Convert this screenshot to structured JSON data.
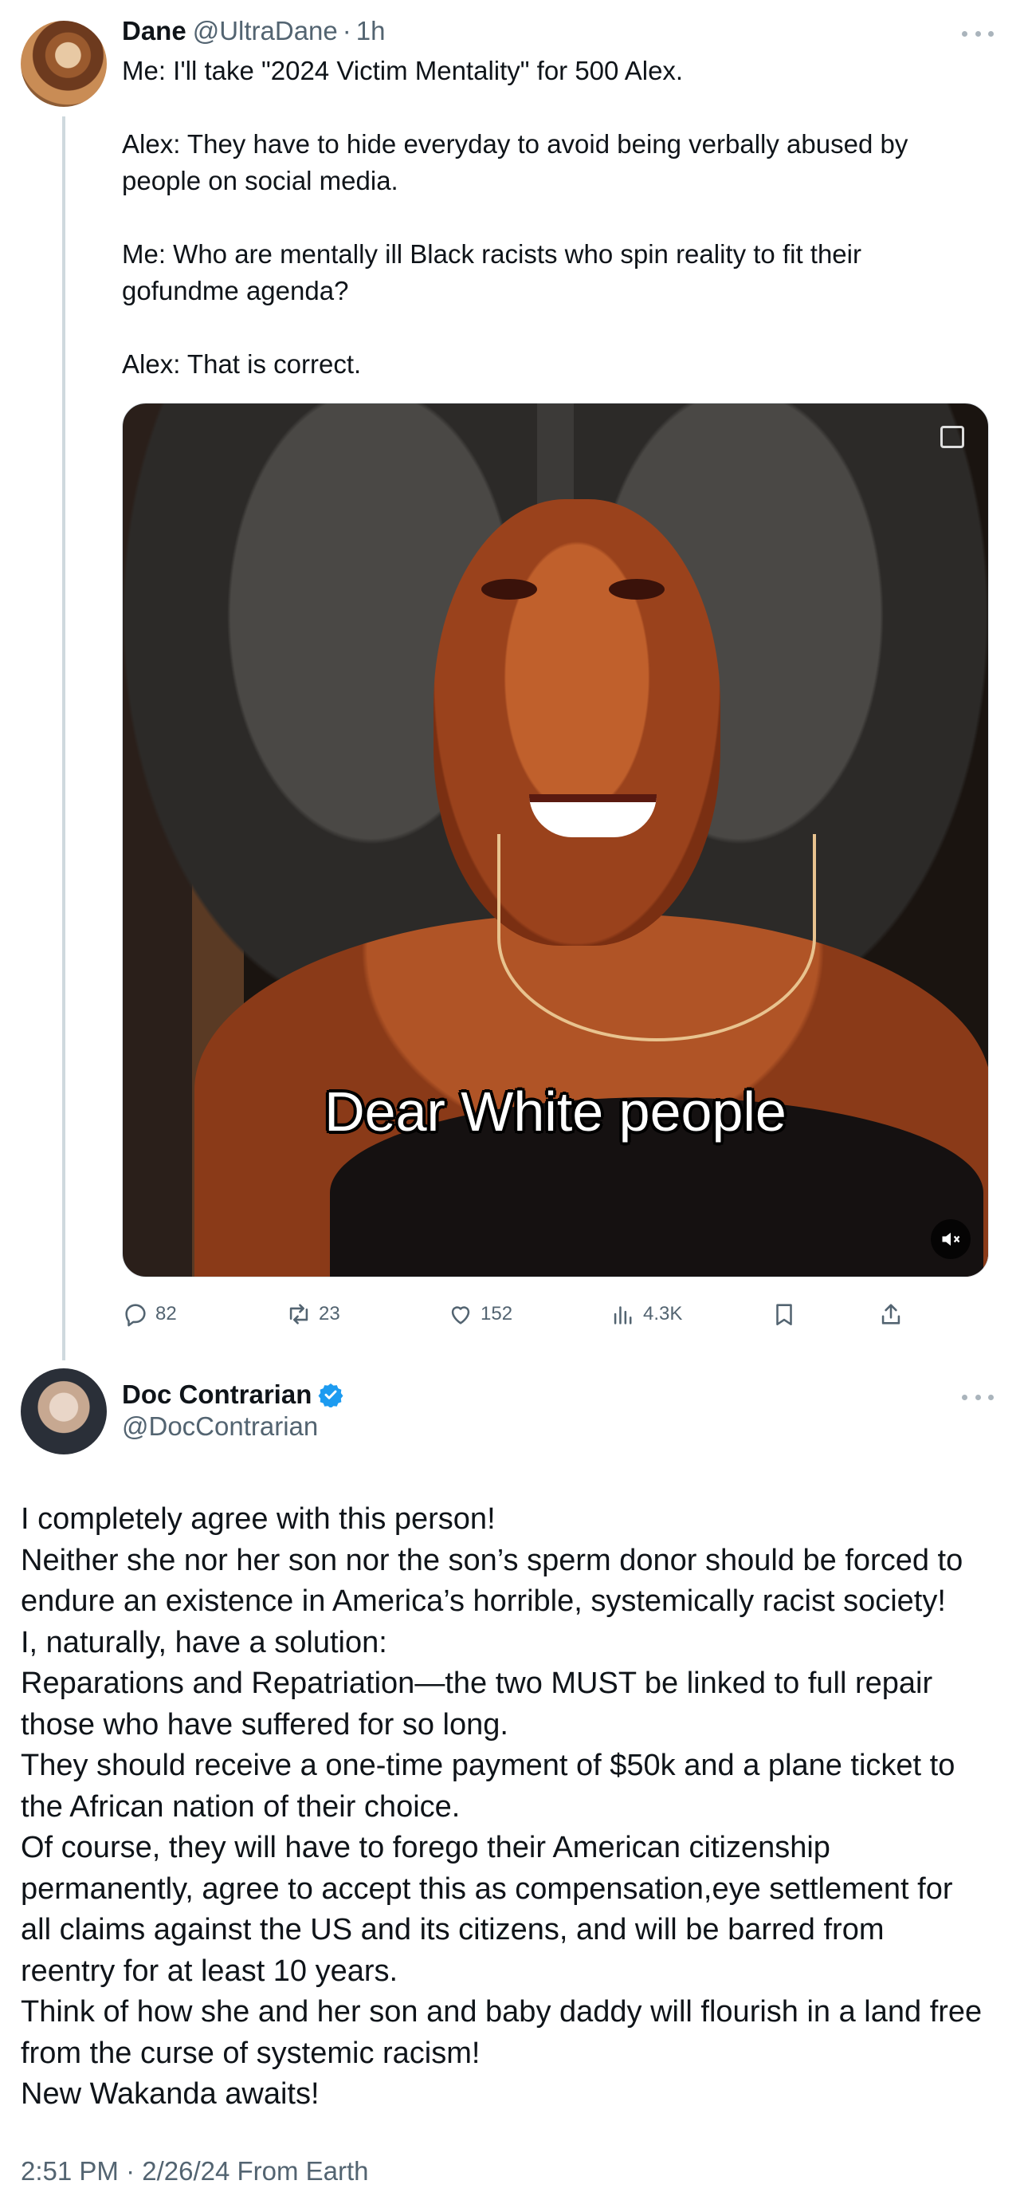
{
  "parent_tweet": {
    "author_name": "Dane",
    "author_handle": "@UltraDane",
    "separator": "·",
    "time": "1h",
    "text_lines": [
      "Me: I'll take \"2024 Victim Mentality\" for 500 Alex.",
      "",
      "Alex: They have to hide everyday to avoid being verbally abused by",
      "people on social media.",
      "",
      "Me: Who are mentally ill Black racists who spin reality to fit their",
      "gofundme agenda?",
      "",
      "Alex: That is correct."
    ],
    "video_caption": "Dear White people",
    "icons": {
      "media_badge": "video-settings-icon",
      "mute": "volume-muted-icon"
    },
    "stats": {
      "replies": "82",
      "reposts": "23",
      "likes": "152",
      "views": "4.3K"
    }
  },
  "reply_tweet": {
    "author_name": "Doc Contrarian",
    "author_handle": "@DocContrarian",
    "verified_color": "#1d9bf0",
    "text_lines": [
      "I completely agree with this person!",
      "Neither she nor her son nor the son’s sperm donor should be forced to",
      "endure an existence in America’s horrible, systemically racist society!",
      "I, naturally, have a solution:",
      "Reparations and Repatriation—the two MUST be linked to full repair",
      "those who have suffered for so long.",
      "They should receive a one-time payment of $50k and a plane ticket to",
      "the African nation of their choice.",
      "Of course, they will have to forego their American citizenship",
      "permanently, agree to accept this as compensation,eye settlement for",
      "all claims against the US and its citizens, and will be barred from",
      "reentry for at least 10 years.",
      "Think of how she and her son and baby daddy will flourish in a land free",
      "from the curse of systemic racism!",
      "New Wakanda awaits!"
    ],
    "timestamp": "2:51 PM · 2/26/24 From Earth"
  },
  "colors": {
    "text_primary": "#0f1419",
    "text_secondary": "#536471",
    "thread_line": "#cfd9de",
    "verified_blue": "#1d9bf0"
  }
}
